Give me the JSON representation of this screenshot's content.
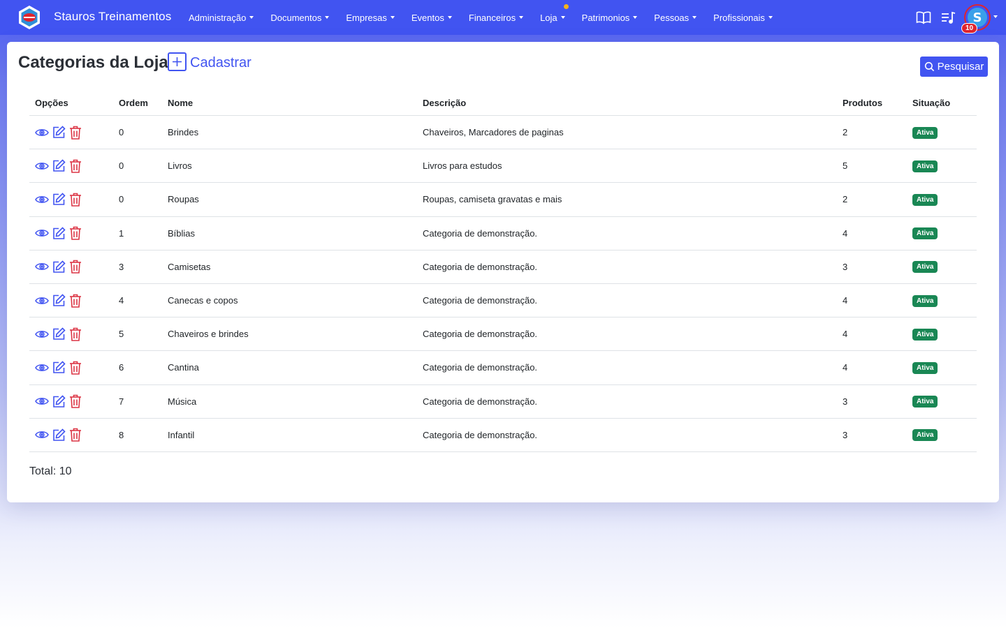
{
  "app": {
    "brand_name": "Stauros Treinamentos"
  },
  "menu": [
    {
      "label": "Administração"
    },
    {
      "label": "Documentos"
    },
    {
      "label": "Empresas"
    },
    {
      "label": "Eventos"
    },
    {
      "label": "Financeiros"
    },
    {
      "label": "Loja"
    },
    {
      "label": "Patrimonios"
    },
    {
      "label": "Pessoas"
    },
    {
      "label": "Profissionais"
    }
  ],
  "user": {
    "avatar_letter": "S",
    "notification_count": "10"
  },
  "page": {
    "title": "Categorias da Loja",
    "add_label": "Cadastrar",
    "search_label": "Pesquisar"
  },
  "table": {
    "headers": {
      "options": "Opções",
      "order": "Ordem",
      "name": "Nome",
      "description": "Descrição",
      "products": "Produtos",
      "status": "Situação"
    },
    "rows": [
      {
        "order": "0",
        "name": "Brindes",
        "description": "Chaveiros, Marcadores de paginas",
        "products": "2",
        "status": "Ativa"
      },
      {
        "order": "0",
        "name": "Livros",
        "description": "Livros para estudos",
        "products": "5",
        "status": "Ativa"
      },
      {
        "order": "0",
        "name": "Roupas",
        "description": "Roupas, camiseta gravatas e mais",
        "products": "2",
        "status": "Ativa"
      },
      {
        "order": "1",
        "name": "Bíblias",
        "description": "Categoria de demonstração.",
        "products": "4",
        "status": "Ativa"
      },
      {
        "order": "3",
        "name": "Camisetas",
        "description": "Categoria de demonstração.",
        "products": "3",
        "status": "Ativa"
      },
      {
        "order": "4",
        "name": "Canecas e copos",
        "description": "Categoria de demonstração.",
        "products": "4",
        "status": "Ativa"
      },
      {
        "order": "5",
        "name": "Chaveiros e brindes",
        "description": "Categoria de demonstração.",
        "products": "4",
        "status": "Ativa"
      },
      {
        "order": "6",
        "name": "Cantina",
        "description": "Categoria de demonstração.",
        "products": "4",
        "status": "Ativa"
      },
      {
        "order": "7",
        "name": "Música",
        "description": "Categoria de demonstração.",
        "products": "3",
        "status": "Ativa"
      },
      {
        "order": "8",
        "name": "Infantil",
        "description": "Categoria de demonstração.",
        "products": "3",
        "status": "Ativa"
      }
    ],
    "total_label": "Total: 10"
  },
  "colors": {
    "primary": "#4154f1",
    "danger": "#dc3545",
    "success": "#198754",
    "notification_dot": "#f6b21b"
  },
  "icons": {
    "view": "eye-icon",
    "edit": "edit-icon",
    "delete": "trash-icon",
    "manual": "book-icon",
    "playlist": "playlist-music-icon",
    "add": "plus-square-icon",
    "search": "search-icon"
  }
}
